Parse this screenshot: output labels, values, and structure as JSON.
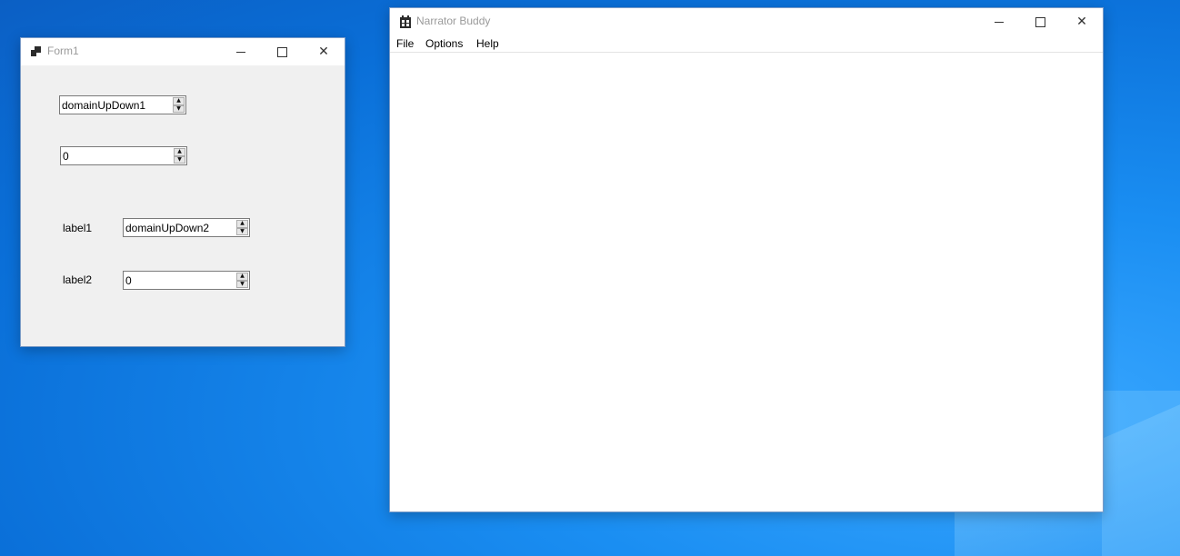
{
  "form1": {
    "title": "Form1",
    "domain_up_down_1": "domainUpDown1",
    "numeric_up_down_1": "0",
    "label1": "label1",
    "domain_up_down_2": "domainUpDown2",
    "label2": "label2",
    "numeric_up_down_2": "0",
    "icons": {
      "app": "form-app-icon",
      "minimize": "minimize-icon",
      "maximize": "maximize-icon",
      "close": "close-icon"
    }
  },
  "narrator": {
    "title": "Narrator Buddy",
    "menu": [
      "File",
      "Options",
      "Help"
    ],
    "icons": {
      "app": "narrator-app-icon",
      "minimize": "minimize-icon",
      "maximize": "maximize-icon",
      "close": "close-icon"
    }
  },
  "colors": {
    "desktop": "#0a6fd8",
    "window_border": "#7a9bc7",
    "form_bg": "#f0f0f0"
  }
}
